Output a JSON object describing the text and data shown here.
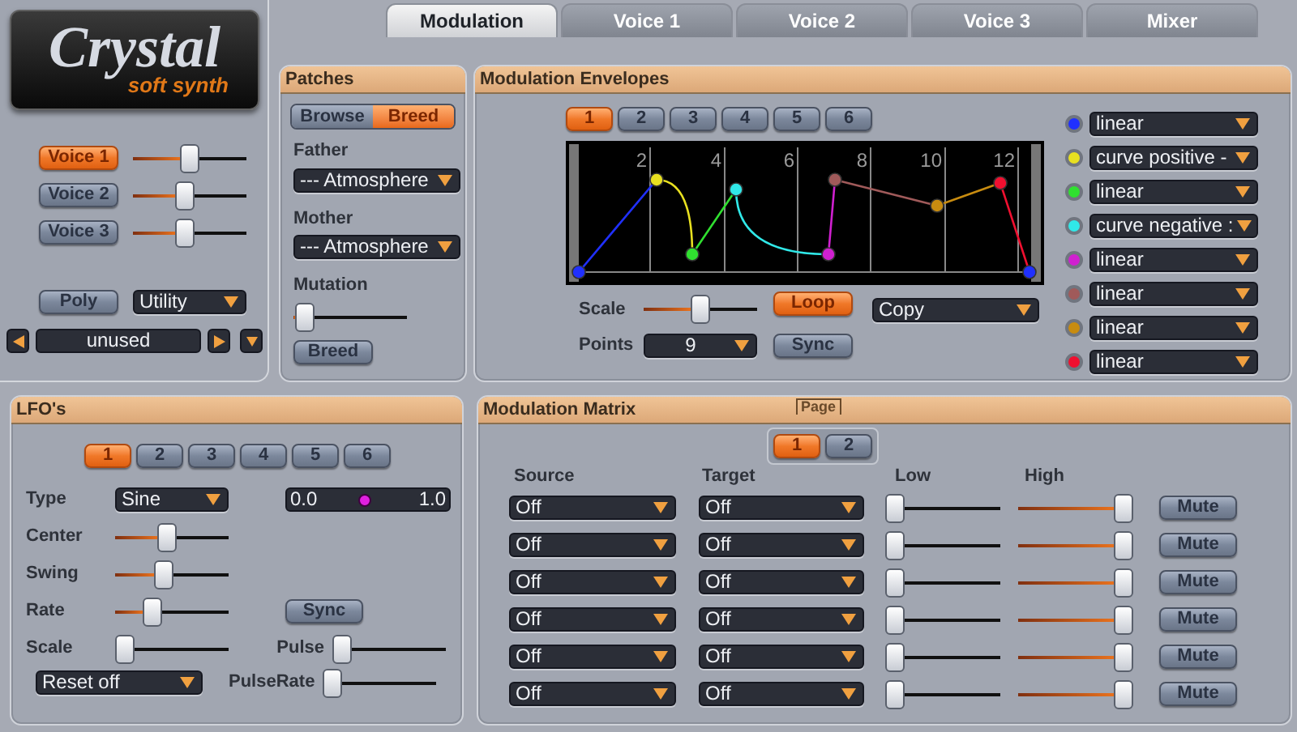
{
  "logo": {
    "title": "Crystal",
    "subtitle": "soft synth"
  },
  "tabs": [
    {
      "label": "Modulation",
      "selected": true
    },
    {
      "label": "Voice 1",
      "selected": false
    },
    {
      "label": "Voice 2",
      "selected": false
    },
    {
      "label": "Voice 3",
      "selected": false
    },
    {
      "label": "Mixer",
      "selected": false
    }
  ],
  "voices": [
    {
      "label": "Voice 1",
      "selected": true,
      "level": 0.5
    },
    {
      "label": "Voice 2",
      "selected": false,
      "level": 0.45
    },
    {
      "label": "Voice 3",
      "selected": false,
      "level": 0.45
    }
  ],
  "poly_button": "Poly",
  "category": "Utility",
  "patch_name": "unused",
  "patches": {
    "title": "Patches",
    "modes": [
      {
        "label": "Browse",
        "selected": false
      },
      {
        "label": "Breed",
        "selected": true
      }
    ],
    "father_label": "Father",
    "father": "--- Atmosphere",
    "mother_label": "Mother",
    "mother": "--- Atmosphere",
    "mutation": {
      "label": "Mutation",
      "level": 0.02
    },
    "breed_button": "Breed"
  },
  "envelopes": {
    "title": "Modulation Envelopes",
    "tabs": [
      {
        "label": "1",
        "selected": true
      },
      {
        "label": "2",
        "selected": false
      },
      {
        "label": "3",
        "selected": false
      },
      {
        "label": "4",
        "selected": false
      },
      {
        "label": "5",
        "selected": false
      },
      {
        "label": "6",
        "selected": false
      }
    ],
    "ticks": [
      "2",
      "4",
      "6",
      "8",
      "10",
      "12"
    ],
    "scale": {
      "label": "Scale",
      "level": 0.5
    },
    "points": {
      "label": "Points",
      "value": "9"
    },
    "loop": {
      "label": "Loop",
      "on": true
    },
    "sync": {
      "label": "Sync",
      "on": false
    },
    "copy": "Copy",
    "segments": [
      {
        "color": "#2030ff",
        "curve": "linear"
      },
      {
        "color": "#e8e020",
        "curve": "curve positive -"
      },
      {
        "color": "#30e030",
        "curve": "linear"
      },
      {
        "color": "#30e8e8",
        "curve": "curve negative :"
      },
      {
        "color": "#d020d0",
        "curve": "linear"
      },
      {
        "color": "#a05a5a",
        "curve": "linear"
      },
      {
        "color": "#c88c10",
        "curve": "linear"
      },
      {
        "color": "#f01030",
        "curve": "linear"
      }
    ]
  },
  "lfo": {
    "title": "LFO's",
    "tabs": [
      {
        "label": "1",
        "selected": true
      },
      {
        "label": "2",
        "selected": false
      },
      {
        "label": "3",
        "selected": false
      },
      {
        "label": "4",
        "selected": false
      },
      {
        "label": "5",
        "selected": false
      },
      {
        "label": "6",
        "selected": false
      }
    ],
    "type_label": "Type",
    "type": "Sine",
    "range": {
      "min": "0.0",
      "max": "1.0",
      "level": 0.48
    },
    "sliders": [
      {
        "label": "Center",
        "level": 0.45
      },
      {
        "label": "Swing",
        "level": 0.42
      },
      {
        "label": "Rate",
        "level": 0.3
      },
      {
        "label": "Scale",
        "level": 0.0
      }
    ],
    "sync": {
      "label": "Sync",
      "on": false
    },
    "pulse": {
      "label": "Pulse",
      "level": 0.0
    },
    "pulse_rate": {
      "label": "PulseRate",
      "level": 0.0
    },
    "reset": "Reset off"
  },
  "matrix": {
    "title": "Modulation Matrix",
    "page_label": "Page",
    "pages": [
      {
        "label": "1",
        "selected": true
      },
      {
        "label": "2",
        "selected": false
      }
    ],
    "columns": [
      "Source",
      "Target",
      "Low",
      "High"
    ],
    "rows": [
      {
        "source": "Off",
        "target": "Off",
        "low": {
          "level": 0
        },
        "high": {
          "level": 1
        },
        "mute": "Mute",
        "muted": false
      },
      {
        "source": "Off",
        "target": "Off",
        "low": {
          "level": 0
        },
        "high": {
          "level": 1
        },
        "mute": "Mute",
        "muted": false
      },
      {
        "source": "Off",
        "target": "Off",
        "low": {
          "level": 0
        },
        "high": {
          "level": 1
        },
        "mute": "Mute",
        "muted": false
      },
      {
        "source": "Off",
        "target": "Off",
        "low": {
          "level": 0
        },
        "high": {
          "level": 1
        },
        "mute": "Mute",
        "muted": false
      },
      {
        "source": "Off",
        "target": "Off",
        "low": {
          "level": 0
        },
        "high": {
          "level": 1
        },
        "mute": "Mute",
        "muted": false
      },
      {
        "source": "Off",
        "target": "Off",
        "low": {
          "level": 0
        },
        "high": {
          "level": 1
        },
        "mute": "Mute",
        "muted": false
      }
    ]
  }
}
